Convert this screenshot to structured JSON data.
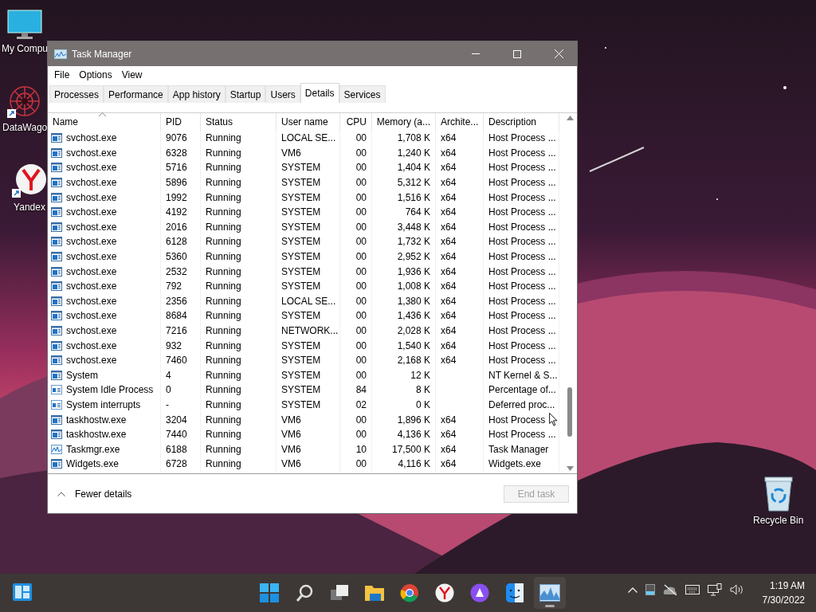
{
  "desktop_icons": [
    {
      "kind": "computer",
      "label": "My Compu"
    },
    {
      "kind": "datawagon",
      "label": "DataWago"
    },
    {
      "kind": "yandex",
      "label": "Yandex"
    },
    {
      "kind": "recycle",
      "label": "Recycle Bin"
    }
  ],
  "window": {
    "title": "Task Manager"
  },
  "menu": [
    "File",
    "Options",
    "View"
  ],
  "tabs": [
    {
      "label": "Processes",
      "selected": false
    },
    {
      "label": "Performance",
      "selected": false
    },
    {
      "label": "App history",
      "selected": false
    },
    {
      "label": "Startup",
      "selected": false
    },
    {
      "label": "Users",
      "selected": false
    },
    {
      "label": "Details",
      "selected": true
    },
    {
      "label": "Services",
      "selected": false
    }
  ],
  "table": {
    "columns": [
      "Name",
      "PID",
      "Status",
      "User name",
      "CPU",
      "Memory (a...",
      "Archite...",
      "Description"
    ],
    "rows": [
      {
        "kind": "window",
        "name": "svchost.exe",
        "pid": "9076",
        "status": "Running",
        "user": "LOCAL SE...",
        "cpu": "00",
        "memory": "1,708 K",
        "architecture": "x64",
        "description": "Host Process ..."
      },
      {
        "kind": "window",
        "name": "svchost.exe",
        "pid": "6328",
        "status": "Running",
        "user": "VM6",
        "cpu": "00",
        "memory": "1,240 K",
        "architecture": "x64",
        "description": "Host Process ..."
      },
      {
        "kind": "window",
        "name": "svchost.exe",
        "pid": "5716",
        "status": "Running",
        "user": "SYSTEM",
        "cpu": "00",
        "memory": "1,404 K",
        "architecture": "x64",
        "description": "Host Process ..."
      },
      {
        "kind": "window",
        "name": "svchost.exe",
        "pid": "5896",
        "status": "Running",
        "user": "SYSTEM",
        "cpu": "00",
        "memory": "5,312 K",
        "architecture": "x64",
        "description": "Host Process ..."
      },
      {
        "kind": "window",
        "name": "svchost.exe",
        "pid": "1992",
        "status": "Running",
        "user": "SYSTEM",
        "cpu": "00",
        "memory": "1,516 K",
        "architecture": "x64",
        "description": "Host Process ..."
      },
      {
        "kind": "window",
        "name": "svchost.exe",
        "pid": "4192",
        "status": "Running",
        "user": "SYSTEM",
        "cpu": "00",
        "memory": "764 K",
        "architecture": "x64",
        "description": "Host Process ..."
      },
      {
        "kind": "window",
        "name": "svchost.exe",
        "pid": "2016",
        "status": "Running",
        "user": "SYSTEM",
        "cpu": "00",
        "memory": "3,448 K",
        "architecture": "x64",
        "description": "Host Process ..."
      },
      {
        "kind": "window",
        "name": "svchost.exe",
        "pid": "6128",
        "status": "Running",
        "user": "SYSTEM",
        "cpu": "00",
        "memory": "1,732 K",
        "architecture": "x64",
        "description": "Host Process ..."
      },
      {
        "kind": "window",
        "name": "svchost.exe",
        "pid": "5360",
        "status": "Running",
        "user": "SYSTEM",
        "cpu": "00",
        "memory": "2,952 K",
        "architecture": "x64",
        "description": "Host Process ..."
      },
      {
        "kind": "window",
        "name": "svchost.exe",
        "pid": "2532",
        "status": "Running",
        "user": "SYSTEM",
        "cpu": "00",
        "memory": "1,936 K",
        "architecture": "x64",
        "description": "Host Process ..."
      },
      {
        "kind": "window",
        "name": "svchost.exe",
        "pid": "792",
        "status": "Running",
        "user": "SYSTEM",
        "cpu": "00",
        "memory": "1,008 K",
        "architecture": "x64",
        "description": "Host Process ..."
      },
      {
        "kind": "window",
        "name": "svchost.exe",
        "pid": "2356",
        "status": "Running",
        "user": "LOCAL SE...",
        "cpu": "00",
        "memory": "1,380 K",
        "architecture": "x64",
        "description": "Host Process ..."
      },
      {
        "kind": "window",
        "name": "svchost.exe",
        "pid": "8684",
        "status": "Running",
        "user": "SYSTEM",
        "cpu": "00",
        "memory": "1,436 K",
        "architecture": "x64",
        "description": "Host Process ..."
      },
      {
        "kind": "window",
        "name": "svchost.exe",
        "pid": "7216",
        "status": "Running",
        "user": "NETWORK...",
        "cpu": "00",
        "memory": "2,028 K",
        "architecture": "x64",
        "description": "Host Process ..."
      },
      {
        "kind": "window",
        "name": "svchost.exe",
        "pid": "932",
        "status": "Running",
        "user": "SYSTEM",
        "cpu": "00",
        "memory": "1,540 K",
        "architecture": "x64",
        "description": "Host Process ..."
      },
      {
        "kind": "window",
        "name": "svchost.exe",
        "pid": "7460",
        "status": "Running",
        "user": "SYSTEM",
        "cpu": "00",
        "memory": "2,168 K",
        "architecture": "x64",
        "description": "Host Process ..."
      },
      {
        "kind": "window",
        "name": "System",
        "pid": "4",
        "status": "Running",
        "user": "SYSTEM",
        "cpu": "00",
        "memory": "12 K",
        "description": "NT Kernel & S..."
      },
      {
        "kind": "plain",
        "name": "System Idle Process",
        "pid": "0",
        "status": "Running",
        "user": "SYSTEM",
        "cpu": "84",
        "memory": "8 K",
        "description": "Percentage of..."
      },
      {
        "kind": "plain",
        "name": "System interrupts",
        "pid": "-",
        "status": "Running",
        "user": "SYSTEM",
        "cpu": "02",
        "memory": "0 K",
        "description": "Deferred proc..."
      },
      {
        "kind": "window",
        "name": "taskhostw.exe",
        "pid": "3204",
        "status": "Running",
        "user": "VM6",
        "cpu": "00",
        "memory": "1,896 K",
        "architecture": "x64",
        "description": "Host Process"
      },
      {
        "kind": "window",
        "name": "taskhostw.exe",
        "pid": "7440",
        "status": "Running",
        "user": "VM6",
        "cpu": "00",
        "memory": "4,136 K",
        "architecture": "x64",
        "description": "Host Process ..."
      },
      {
        "kind": "chart",
        "name": "Taskmgr.exe",
        "pid": "6188",
        "status": "Running",
        "user": "VM6",
        "cpu": "10",
        "memory": "17,500 K",
        "architecture": "x64",
        "description": "Task Manager"
      },
      {
        "kind": "window",
        "name": "Widgets.exe",
        "pid": "6728",
        "status": "Running",
        "user": "VM6",
        "cpu": "00",
        "memory": "4,116 K",
        "architecture": "x64",
        "description": "Widgets.exe"
      }
    ]
  },
  "footer": {
    "toggle": "Fewer details",
    "end_task": {
      "label": "End task",
      "disabled": true
    }
  },
  "taskbar": {
    "apps": [
      {
        "kind": "start",
        "active": false
      },
      {
        "kind": "search",
        "active": false
      },
      {
        "kind": "taskview",
        "active": false
      },
      {
        "kind": "folder",
        "active": false
      },
      {
        "kind": "chrome",
        "active": false
      },
      {
        "kind": "yandex",
        "active": false
      },
      {
        "kind": "assistant",
        "active": false
      },
      {
        "kind": "finder",
        "active": false
      },
      {
        "kind": "taskmgr",
        "active": true
      }
    ],
    "time": "1:19 AM",
    "date": "7/30/2022"
  }
}
